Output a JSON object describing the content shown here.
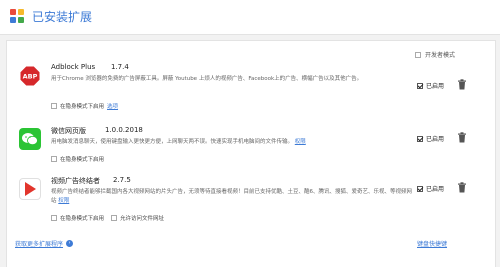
{
  "header": {
    "title": "已安装扩展"
  },
  "dev_mode": {
    "label": "开发者模式",
    "checked": false
  },
  "extensions": [
    {
      "name": "Adblock Plus",
      "version": "1.7.4",
      "icon_text": "ABP",
      "icon_name": "adblock-plus-icon",
      "description": "用于Chrome 浏览器的免费的广告屏蔽工具。屏蔽 Youtube 上烦人的视频广告、Facebook上的广告、横幅广告以及其他广告。",
      "incognito_label": "在隐身模式下启用",
      "incognito_checked": false,
      "options_link": "选项",
      "enabled_label": "已启用",
      "enabled": true
    },
    {
      "name": "微信网页版",
      "version": "1.0.0.2018",
      "icon_name": "wechat-icon",
      "description": "用电脑发消息聊天，使用键盘输入更快更方便，上网聊天两不误。快速实现手机电脑间的文件传输。",
      "permissions_link": "权限",
      "incognito_label": "在隐身模式下启用",
      "incognito_checked": false,
      "enabled_label": "已启用",
      "enabled": true
    },
    {
      "name": "视频广告终结者",
      "version": "2.7.5",
      "icon_name": "video-play-icon",
      "description": "视频广告终结者能够拦截国内各大视频网站的片头广告，无须等待直接看视频！目前已支持优酷、土豆、酷6、腾讯、搜狐、爱奇艺、乐视、等视频网站",
      "permissions_link": "权限",
      "incognito_label": "在隐身模式下启用",
      "incognito_checked": false,
      "file_access_label": "允许访问文件网址",
      "file_access_checked": false,
      "enabled_label": "已启用",
      "enabled": true
    }
  ],
  "footer": {
    "more_extensions": "获取更多扩展程序",
    "keyboard_shortcuts": "键盘快捷键"
  },
  "colors": {
    "accent": "#3e7bd6",
    "abp_red": "#d6282b",
    "wechat_green": "#2bc434",
    "video_red": "#e2352c"
  }
}
